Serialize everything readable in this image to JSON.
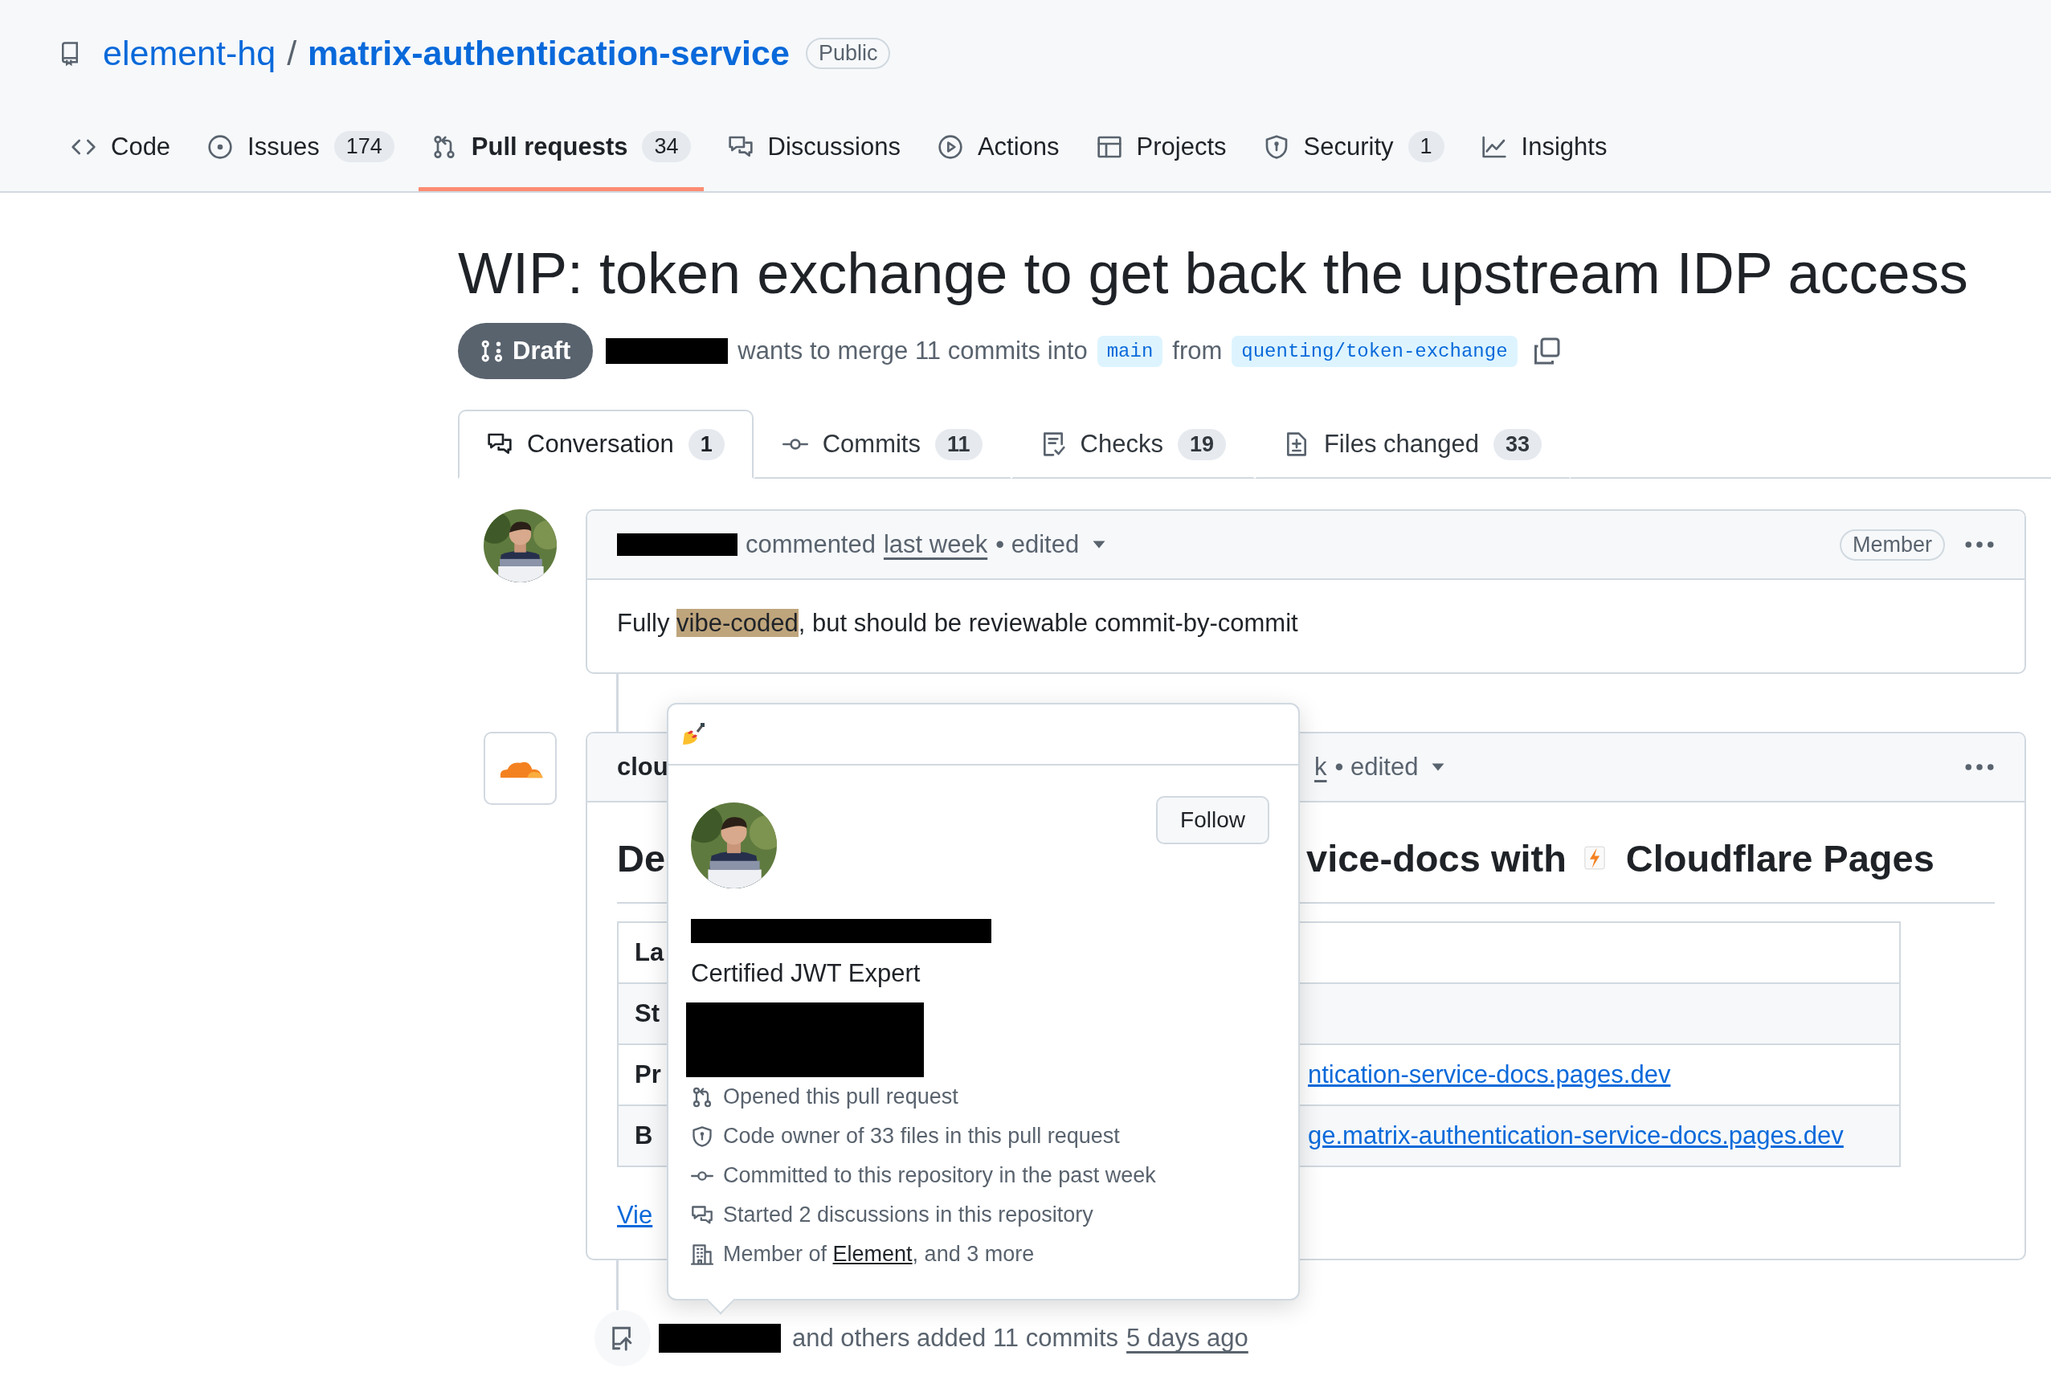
{
  "repo": {
    "owner": "element-hq",
    "separator": "/",
    "name": "matrix-authentication-service",
    "visibility": "Public"
  },
  "nav_tabs": [
    {
      "label": "Code",
      "selected": false
    },
    {
      "label": "Issues",
      "count": "174",
      "selected": false
    },
    {
      "label": "Pull requests",
      "count": "34",
      "selected": true
    },
    {
      "label": "Discussions",
      "selected": false
    },
    {
      "label": "Actions",
      "selected": false
    },
    {
      "label": "Projects",
      "selected": false
    },
    {
      "label": "Security",
      "count": "1",
      "selected": false
    },
    {
      "label": "Insights",
      "selected": false
    }
  ],
  "pull_request": {
    "title": "WIP: token exchange to get back the upstream IDP access",
    "status": "Draft",
    "summary": "wants to merge 11 commits into",
    "base_branch": "main",
    "from": "from",
    "head_branch": "quenting/token-exchange"
  },
  "pr_tabs": [
    {
      "label": "Conversation",
      "count": "1",
      "selected": true
    },
    {
      "label": "Commits",
      "count": "11",
      "selected": false
    },
    {
      "label": "Checks",
      "count": "19",
      "selected": false
    },
    {
      "label": "Files changed",
      "count": "33",
      "selected": false
    }
  ],
  "comment": {
    "action": "commented",
    "time": "last week",
    "edited": "• edited",
    "role": "Member",
    "body": {
      "before": "Fully ",
      "highlight": "vibe-coded",
      "after": ", but should be reviewable commit-by-commit"
    }
  },
  "bot_comment": {
    "author": "clou",
    "time": "k",
    "edited": "• edited",
    "heading_start": "De",
    "heading_end": "vice-docs with",
    "heading_tail": "Cloudflare Pages",
    "table_rows": [
      {
        "label": "La"
      },
      {
        "label": "St"
      },
      {
        "label": "Pr",
        "link": "ntication-service-docs.pages.dev"
      },
      {
        "label": "B",
        "link": "ge.matrix-authentication-service-docs.pages.dev"
      }
    ],
    "footer_link": "Vie"
  },
  "hovercard": {
    "follow": "Follow",
    "bio": "Certified JWT Expert",
    "facts": [
      {
        "text": "Opened this pull request"
      },
      {
        "text": "Code owner of 33 files in this pull request"
      },
      {
        "text": "Committed to this repository in the past week"
      },
      {
        "text": "Started 2 discussions in this repository"
      },
      {
        "text": "Member of ",
        "link": "Element",
        "after": ", and 3 more"
      }
    ]
  },
  "timeline_event": {
    "text": "and others added 11 commits",
    "time": "5 days ago"
  }
}
